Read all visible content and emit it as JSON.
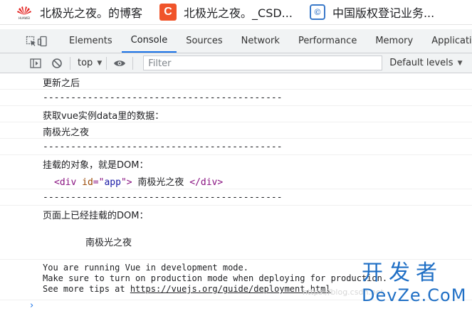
{
  "bookmarks": [
    {
      "icon": "huawei-icon",
      "icon_text": "HUAWEI",
      "label": "北极光之夜。的博客"
    },
    {
      "icon": "csdn-icon",
      "icon_text": "C",
      "label": "北极光之夜。_CSD..."
    },
    {
      "icon": "copyright-icon",
      "icon_text": "©",
      "label": "中国版权登记业务..."
    }
  ],
  "devtools": {
    "tabs": [
      "Elements",
      "Console",
      "Sources",
      "Network",
      "Performance",
      "Memory",
      "Applicatio"
    ],
    "active_tab": "Console"
  },
  "console_toolbar": {
    "context": "top",
    "filter_placeholder": "Filter",
    "levels": "Default levels"
  },
  "console": {
    "line1": "更新之后",
    "sep1": "-------------------------------------------",
    "line2": "获取vue实例data里的数据：",
    "line3": "南极光之夜",
    "sep2": "-------------------------------------------",
    "line4": "挂载的对象，就是DOM：",
    "dom_tag_open": "<div",
    "dom_attr": "id",
    "dom_eq": "=\"",
    "dom_val": "app",
    "dom_close_quote": "\">",
    "dom_text": " 南极光之夜 ",
    "dom_tag_close": "</div>",
    "sep3": "-------------------------------------------",
    "line5": "页面上已经挂载的DOM：",
    "rendered_text": "南极光之夜",
    "vue_msg_1": "You are running Vue in development mode.",
    "vue_msg_2": "Make sure to turn on production mode when deploying for production.",
    "vue_msg_3_prefix": "See more tips at ",
    "vue_msg_3_link": "https://vuejs.org/guide/deployment.html",
    "prompt": "›"
  },
  "watermark": {
    "url": "https://blog.csdn.net",
    "logo_top": "开发者",
    "logo_bottom": "DevZe.CoM"
  },
  "colors": {
    "active_tab": "#1a73e8",
    "html_tag": "#881280",
    "html_attr": "#994500",
    "html_value": "#1a1aa6",
    "logo": "#1f6fc5"
  }
}
